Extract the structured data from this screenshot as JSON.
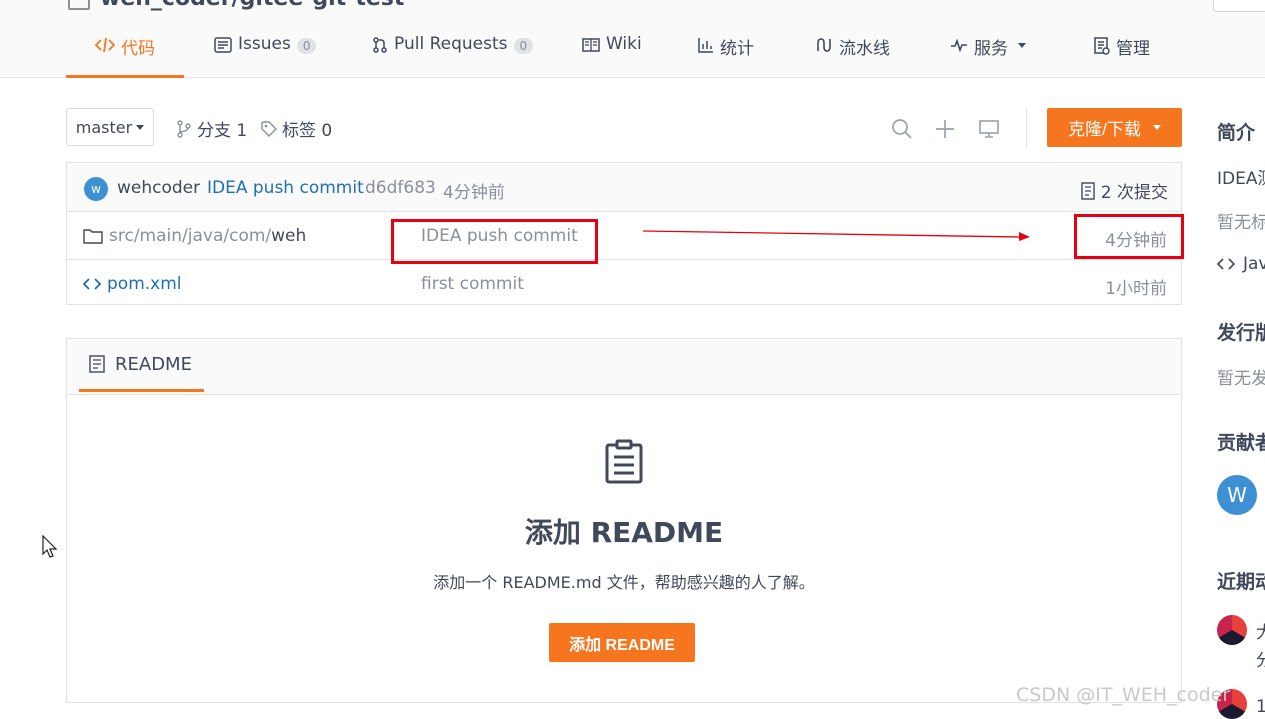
{
  "colors": {
    "accent": "#f5761f",
    "link": "#40485b",
    "muted": "#8a8f99",
    "annotation": "#e60012",
    "avatar": "#3e90d4"
  },
  "tabs": [
    {
      "label": "代码",
      "icon": "code-icon",
      "active": true
    },
    {
      "label": "Issues",
      "count": "0",
      "icon": "issues-icon"
    },
    {
      "label": "Pull Requests",
      "count": "0",
      "icon": "pull-request-icon"
    },
    {
      "label": "Wiki",
      "icon": "wiki-icon"
    },
    {
      "label": "统计",
      "icon": "stats-icon"
    },
    {
      "label": "流水线",
      "icon": "pipeline-icon"
    },
    {
      "label": "服务",
      "icon": "service-icon"
    },
    {
      "label": "管理",
      "icon": "manage-icon"
    }
  ],
  "toolbar": {
    "branch": "master",
    "branches_label": "分支 1",
    "tags_label": "标签 0",
    "clone_label": "克隆/下载"
  },
  "commit": {
    "author": "wehcoder",
    "avatar_letter": "w",
    "message": "IDEA push commit",
    "hash": "d6df683",
    "time": "4分钟前",
    "count_label": "2 次提交"
  },
  "files": [
    {
      "type": "folder",
      "path_prefix": "src/main/java/com/",
      "path_last": "weh",
      "message": "IDEA push commit",
      "time": "4分钟前"
    },
    {
      "type": "file",
      "name": "pom.xml",
      "message": "first commit",
      "time": "1小时前"
    }
  ],
  "readme": {
    "tab_label": "README",
    "title": "添加 README",
    "desc": "添加一个 README.md 文件，帮助感兴趣的人了解。",
    "button": "添加 README"
  },
  "sidebar": {
    "intro_title": "简介",
    "intro_text": "IDEA测",
    "no_tags": "暂无标",
    "language": "Jav",
    "release_title": "发行版",
    "no_release": "暂无发",
    "contrib_title": "贡献者",
    "contrib_letter": "W",
    "activity_title": "近期动",
    "activity_1a": "大",
    "activity_1b": "分",
    "activity_2": "1"
  },
  "watermark": "CSDN @IT_WEH_coder"
}
